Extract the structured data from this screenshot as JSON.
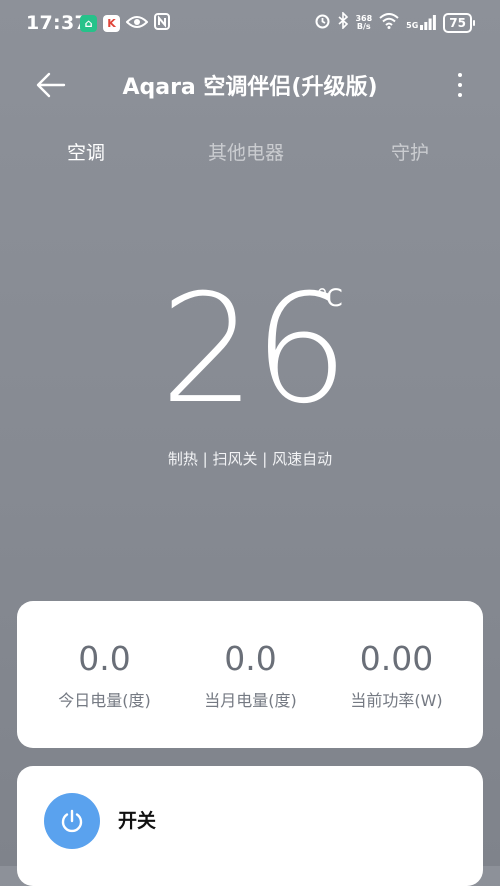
{
  "status_bar": {
    "time": "17:37",
    "net_speed_value": "368",
    "net_speed_unit": "B/s",
    "signal_label": "5G",
    "battery": "75"
  },
  "header": {
    "title": "Aqara 空调伴侣(升级版)"
  },
  "tabs": [
    {
      "label": "空调",
      "active": true
    },
    {
      "label": "其他电器",
      "active": false
    },
    {
      "label": "守护",
      "active": false
    }
  ],
  "ac": {
    "temperature": "26",
    "unit": "℃",
    "mode_summary": "制热 | 扫风关 | 风速自动"
  },
  "energy": [
    {
      "value": "0.0",
      "label": "今日电量(度)"
    },
    {
      "value": "0.0",
      "label": "当月电量(度)"
    },
    {
      "value": "0.00",
      "label": "当前功率(W)"
    }
  ],
  "power": {
    "label": "开关"
  },
  "colors": {
    "background": "#8a8e96",
    "accent": "#5aa2ee",
    "card": "#ffffff"
  }
}
